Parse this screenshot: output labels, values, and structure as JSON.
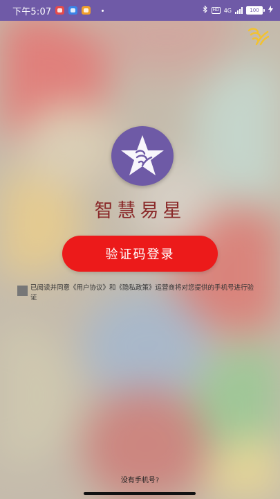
{
  "status_bar": {
    "time": "下午5:07",
    "network_type": "4G",
    "hd_label": "HD",
    "battery": "100",
    "icons": [
      "red-app-notification-icon",
      "blue-app-notification-icon",
      "orange-app-notification-icon",
      "dot-icon",
      "bluetooth-icon",
      "hd-icon",
      "signal-icon",
      "battery-icon",
      "charging-icon"
    ]
  },
  "app": {
    "name": "智慧易星",
    "logo_icon": "star-phoenix-logo-icon",
    "corner_logo_icon": "phoenix-logo-icon"
  },
  "login": {
    "button_label": "验证码登录"
  },
  "agreement": {
    "text": "已阅读并同意《用户协议》和《隐私政策》运营商将对您提供的手机号进行验证",
    "checked": false
  },
  "footer": {
    "no_phone_label": "没有手机号?"
  },
  "colors": {
    "status_bar": "#6f5aa7",
    "primary_button": "#ec1a1a",
    "app_name": "#8a2a2a",
    "logo_bg": "#6e5aa6"
  }
}
